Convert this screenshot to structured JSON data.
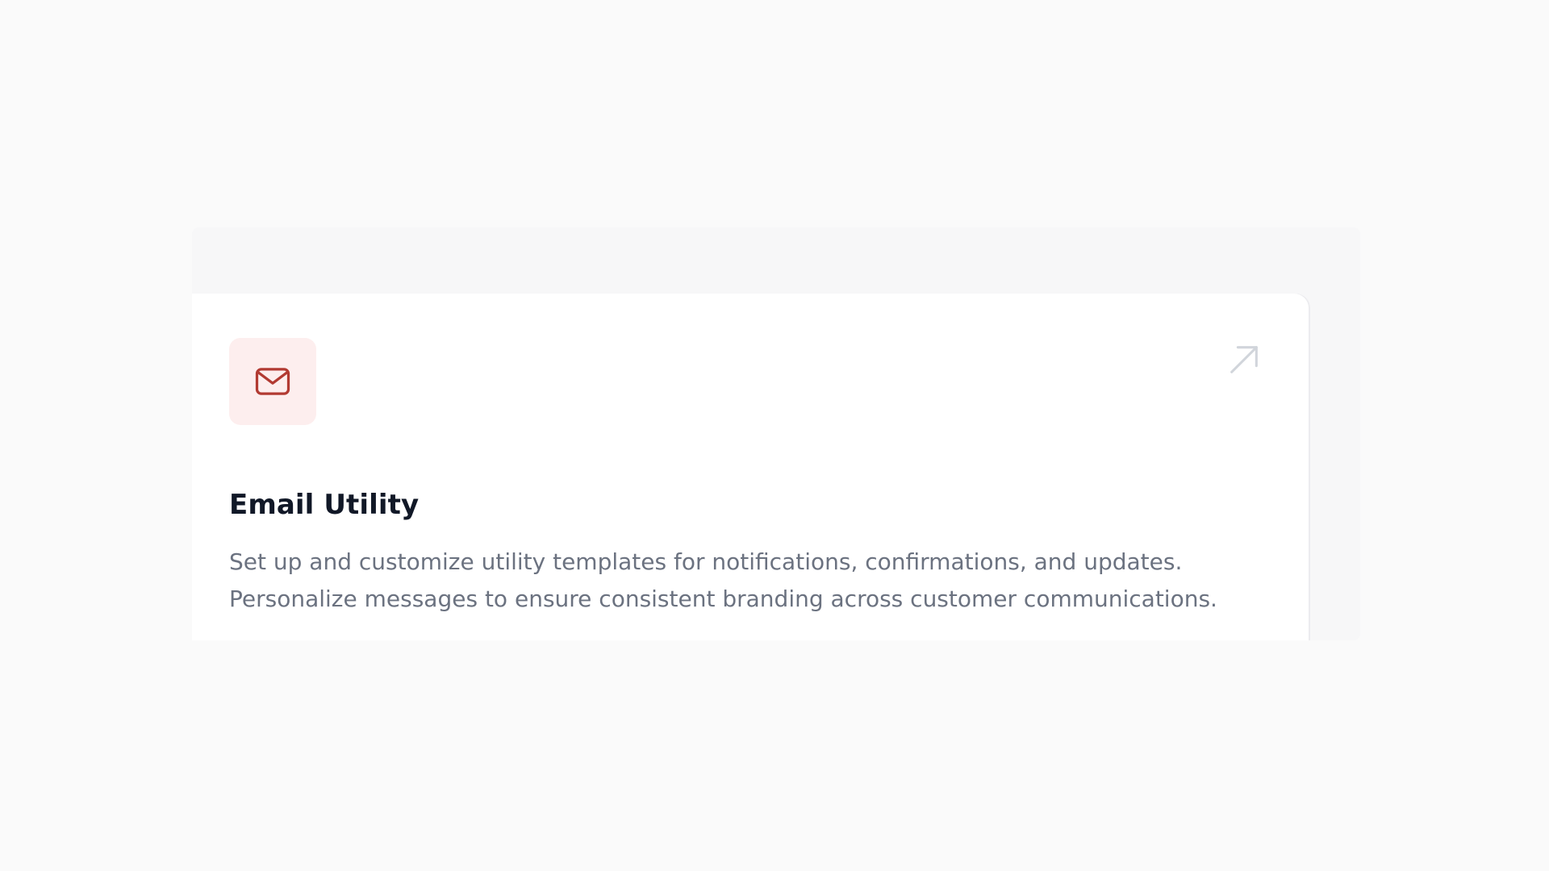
{
  "card": {
    "title": "Email Utility",
    "description": "Set up and customize utility templates for notifications, confirmations, and updates. Personalize messages to ensure consistent branding across customer communications.",
    "icon": "mail-icon",
    "action_icon": "arrow-up-right-icon"
  },
  "colors": {
    "page_background": "#fafafa",
    "card_background": "#ffffff",
    "icon_tile_background": "#fdeeee",
    "icon_stroke": "#b23a32",
    "title_text": "#111827",
    "description_text": "#6b7280",
    "action_icon_stroke": "#d1d5db"
  }
}
